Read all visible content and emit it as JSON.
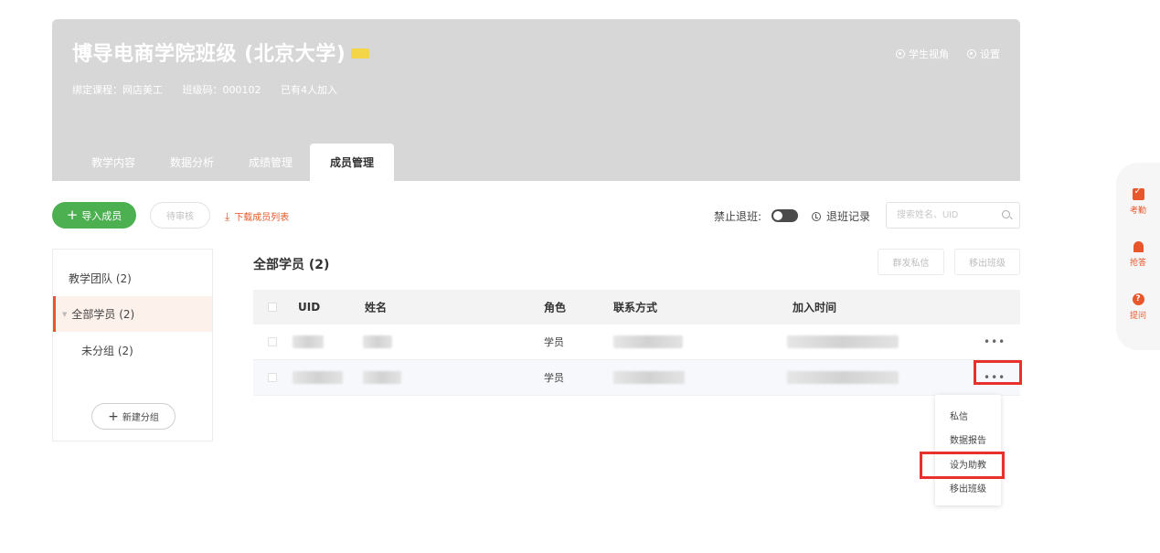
{
  "banner": {
    "title": "博导电商学院班级 (北京大学)",
    "course": "绑定课程：网店美工",
    "class_code": "班级码：000102",
    "joined": "已有4人加入",
    "student_view": "学生视角",
    "settings": "设置"
  },
  "tabs": [
    {
      "label": "教学内容"
    },
    {
      "label": "数据分析"
    },
    {
      "label": "成绩管理"
    },
    {
      "label": "成员管理",
      "active": true
    }
  ],
  "toolbar": {
    "import": "导入成员",
    "pending": "待审核",
    "download": "下载成员列表",
    "forbid_quit": "禁止退班:",
    "quit_record": "退班记录",
    "search_placeholder": "搜索姓名、UID"
  },
  "sidebar": {
    "team": "教学团队 (2)",
    "all": "全部学员 (2)",
    "ungrouped": "未分组 (2)",
    "new_group": "新建分组"
  },
  "main": {
    "title": "全部学员 (2)",
    "bulk_message": "群发私信",
    "remove": "移出班级",
    "columns": [
      "UID",
      "姓名",
      "角色",
      "联系方式",
      "加入时间"
    ],
    "rows": [
      {
        "role": "学员"
      },
      {
        "role": "学员"
      }
    ],
    "more": "•••"
  },
  "dropdown": {
    "items": [
      "私信",
      "数据报告",
      "设为助教",
      "移出班级"
    ]
  },
  "floatbar": {
    "attendance": "考勤",
    "grab": "抢答",
    "question": "提问"
  },
  "colors": {
    "accent": "#e8572b",
    "primary_green": "#4caf50",
    "highlight": "#e8312d",
    "banner_bg": "#d7d7d7"
  }
}
